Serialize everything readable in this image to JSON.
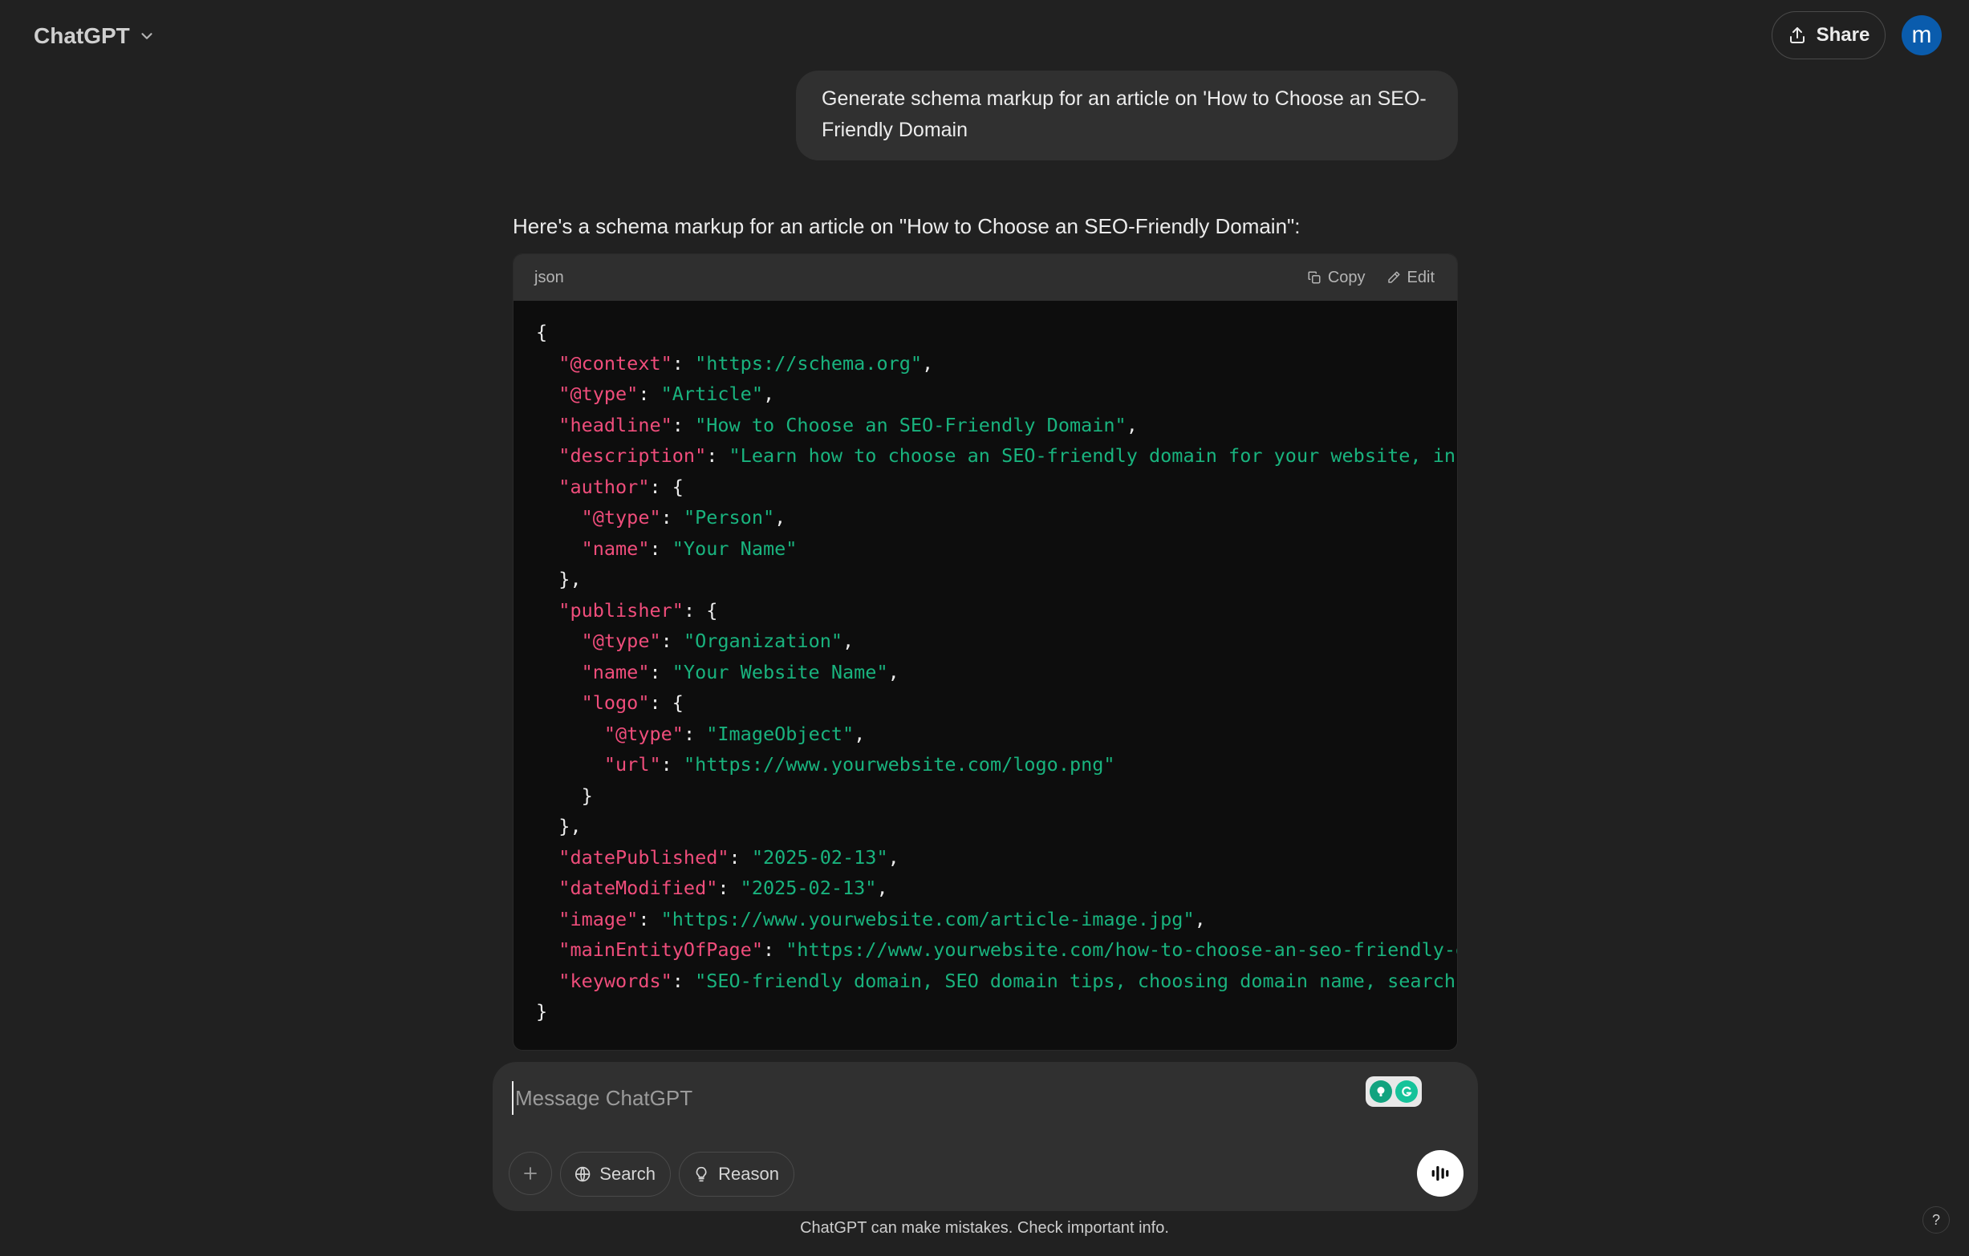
{
  "header": {
    "model_name": "ChatGPT",
    "share_label": "Share",
    "avatar_initial": "m"
  },
  "conversation": {
    "user_message": "Generate schema markup for an article on 'How to Choose an SEO-Friendly Domain",
    "assistant_intro": "Here's a schema markup for an article on \"How to Choose an SEO-Friendly Domain\":",
    "code_block": {
      "language": "json",
      "copy_label": "Copy",
      "edit_label": "Edit",
      "lines": [
        [
          {
            "t": "p",
            "v": "{"
          }
        ],
        [
          {
            "t": "p",
            "v": "  "
          },
          {
            "t": "k",
            "v": "\"@context\""
          },
          {
            "t": "p",
            "v": ": "
          },
          {
            "t": "s",
            "v": "\"https://schema.org\""
          },
          {
            "t": "p",
            "v": ","
          }
        ],
        [
          {
            "t": "p",
            "v": "  "
          },
          {
            "t": "k",
            "v": "\"@type\""
          },
          {
            "t": "p",
            "v": ": "
          },
          {
            "t": "s",
            "v": "\"Article\""
          },
          {
            "t": "p",
            "v": ","
          }
        ],
        [
          {
            "t": "p",
            "v": "  "
          },
          {
            "t": "k",
            "v": "\"headline\""
          },
          {
            "t": "p",
            "v": ": "
          },
          {
            "t": "s",
            "v": "\"How to Choose an SEO-Friendly Domain\""
          },
          {
            "t": "p",
            "v": ","
          }
        ],
        [
          {
            "t": "p",
            "v": "  "
          },
          {
            "t": "k",
            "v": "\"description\""
          },
          {
            "t": "p",
            "v": ": "
          },
          {
            "t": "s",
            "v": "\"Learn how to choose an SEO-friendly domain for your website, includ"
          }
        ],
        [
          {
            "t": "p",
            "v": "  "
          },
          {
            "t": "k",
            "v": "\"author\""
          },
          {
            "t": "p",
            "v": ": {"
          }
        ],
        [
          {
            "t": "p",
            "v": "    "
          },
          {
            "t": "k",
            "v": "\"@type\""
          },
          {
            "t": "p",
            "v": ": "
          },
          {
            "t": "s",
            "v": "\"Person\""
          },
          {
            "t": "p",
            "v": ","
          }
        ],
        [
          {
            "t": "p",
            "v": "    "
          },
          {
            "t": "k",
            "v": "\"name\""
          },
          {
            "t": "p",
            "v": ": "
          },
          {
            "t": "s",
            "v": "\"Your Name\""
          }
        ],
        [
          {
            "t": "p",
            "v": "  },"
          }
        ],
        [
          {
            "t": "p",
            "v": "  "
          },
          {
            "t": "k",
            "v": "\"publisher\""
          },
          {
            "t": "p",
            "v": ": {"
          }
        ],
        [
          {
            "t": "p",
            "v": "    "
          },
          {
            "t": "k",
            "v": "\"@type\""
          },
          {
            "t": "p",
            "v": ": "
          },
          {
            "t": "s",
            "v": "\"Organization\""
          },
          {
            "t": "p",
            "v": ","
          }
        ],
        [
          {
            "t": "p",
            "v": "    "
          },
          {
            "t": "k",
            "v": "\"name\""
          },
          {
            "t": "p",
            "v": ": "
          },
          {
            "t": "s",
            "v": "\"Your Website Name\""
          },
          {
            "t": "p",
            "v": ","
          }
        ],
        [
          {
            "t": "p",
            "v": "    "
          },
          {
            "t": "k",
            "v": "\"logo\""
          },
          {
            "t": "p",
            "v": ": {"
          }
        ],
        [
          {
            "t": "p",
            "v": "      "
          },
          {
            "t": "k",
            "v": "\"@type\""
          },
          {
            "t": "p",
            "v": ": "
          },
          {
            "t": "s",
            "v": "\"ImageObject\""
          },
          {
            "t": "p",
            "v": ","
          }
        ],
        [
          {
            "t": "p",
            "v": "      "
          },
          {
            "t": "k",
            "v": "\"url\""
          },
          {
            "t": "p",
            "v": ": "
          },
          {
            "t": "s",
            "v": "\"https://www.yourwebsite.com/logo.png\""
          }
        ],
        [
          {
            "t": "p",
            "v": "    }"
          }
        ],
        [
          {
            "t": "p",
            "v": "  },"
          }
        ],
        [
          {
            "t": "p",
            "v": "  "
          },
          {
            "t": "k",
            "v": "\"datePublished\""
          },
          {
            "t": "p",
            "v": ": "
          },
          {
            "t": "s",
            "v": "\"2025-02-13\""
          },
          {
            "t": "p",
            "v": ","
          }
        ],
        [
          {
            "t": "p",
            "v": "  "
          },
          {
            "t": "k",
            "v": "\"dateModified\""
          },
          {
            "t": "p",
            "v": ": "
          },
          {
            "t": "s",
            "v": "\"2025-02-13\""
          },
          {
            "t": "p",
            "v": ","
          }
        ],
        [
          {
            "t": "p",
            "v": "  "
          },
          {
            "t": "k",
            "v": "\"image\""
          },
          {
            "t": "p",
            "v": ": "
          },
          {
            "t": "s",
            "v": "\"https://www.yourwebsite.com/article-image.jpg\""
          },
          {
            "t": "p",
            "v": ","
          }
        ],
        [
          {
            "t": "p",
            "v": "  "
          },
          {
            "t": "k",
            "v": "\"mainEntityOfPage\""
          },
          {
            "t": "p",
            "v": ": "
          },
          {
            "t": "s",
            "v": "\"https://www.yourwebsite.com/how-to-choose-an-seo-friendly-doma"
          }
        ],
        [
          {
            "t": "p",
            "v": "  "
          },
          {
            "t": "k",
            "v": "\"keywords\""
          },
          {
            "t": "p",
            "v": ": "
          },
          {
            "t": "s",
            "v": "\"SEO-friendly domain, SEO domain tips, choosing domain name, search eng"
          }
        ],
        [
          {
            "t": "p",
            "v": "}"
          }
        ]
      ]
    }
  },
  "composer": {
    "placeholder": "Message ChatGPT",
    "value": "",
    "search_label": "Search",
    "reason_label": "Reason"
  },
  "footer": {
    "disclaimer": "ChatGPT can make mistakes. Check important info.",
    "help_label": "?"
  },
  "colors": {
    "background": "#212121",
    "bubble": "#303030",
    "code_bg": "#0d0d0d",
    "code_header": "#2f2f2f",
    "json_key": "#ef4d7b",
    "json_string": "#19b37e",
    "avatar": "#0a5cad"
  },
  "icons": {
    "model_dropdown": "chevron-down-icon",
    "share": "upload-icon",
    "copy": "copy-icon",
    "edit": "pencil-icon",
    "attach": "plus-icon",
    "search": "globe-icon",
    "reason": "lightbulb-icon",
    "voice": "voice-waveform-icon",
    "grammarly": "grammarly-icon"
  }
}
